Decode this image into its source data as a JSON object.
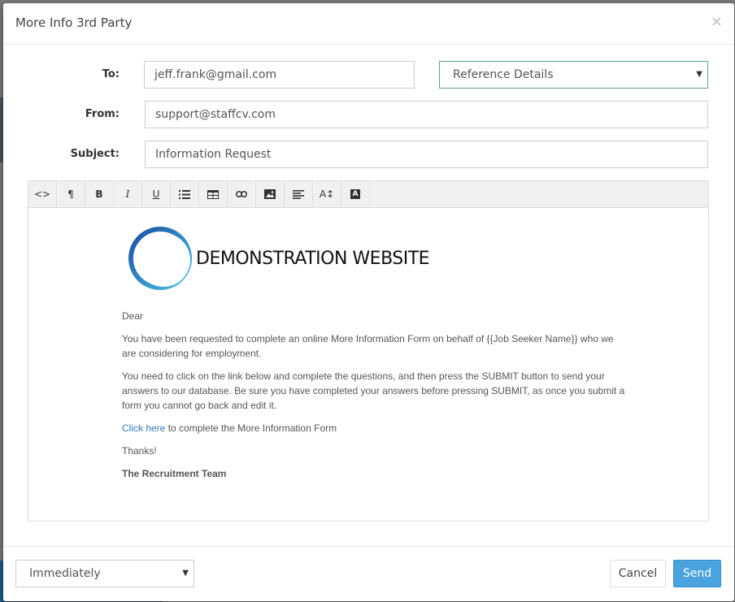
{
  "modal": {
    "title": "More Info 3rd Party",
    "close_label": "×"
  },
  "form": {
    "to_label": "To:",
    "to_value": "jeff.frank@gmail.com",
    "template_select": "Reference Details",
    "from_label": "From:",
    "from_value": "support@staffcv.com",
    "subject_label": "Subject:",
    "subject_value": "Information Request"
  },
  "toolbar": {
    "buttons": [
      {
        "name": "code-view",
        "glyph": "<>"
      },
      {
        "name": "paragraph",
        "glyph": "¶"
      },
      {
        "name": "bold",
        "glyph": "B"
      },
      {
        "name": "italic",
        "glyph": "I"
      },
      {
        "name": "underline",
        "glyph": "U"
      },
      {
        "name": "unordered-list-icon",
        "glyph": ""
      },
      {
        "name": "table-icon",
        "glyph": ""
      },
      {
        "name": "link-icon",
        "glyph": ""
      },
      {
        "name": "image-icon",
        "glyph": ""
      },
      {
        "name": "align-icon",
        "glyph": ""
      },
      {
        "name": "font-size-icon",
        "glyph": "A↕"
      },
      {
        "name": "font-color-icon",
        "glyph": "A"
      }
    ]
  },
  "email": {
    "logo_text": "DEMONSTRATION WEBSITE",
    "greeting": "Dear",
    "para1": "You have been requested to complete an online More Information Form on behalf of {{Job Seeker Name}} who we are considering for employment.",
    "para2": "You need to click on the link below and complete the questions, and then press the SUBMIT button to send your answers to our database. Be sure you have completed your answers before pressing SUBMIT, as once you submit a form you cannot go back and edit it.",
    "link_text": "Click here",
    "link_suffix": " to complete the More Information Form",
    "thanks": "Thanks!",
    "signature": "The Recruitment Team"
  },
  "footer": {
    "schedule": "Immediately",
    "cancel_label": "Cancel",
    "send_label": "Send"
  },
  "colors": {
    "accent": "#4aa3df",
    "select_border": "#5aa57f",
    "link": "#337ab7"
  }
}
